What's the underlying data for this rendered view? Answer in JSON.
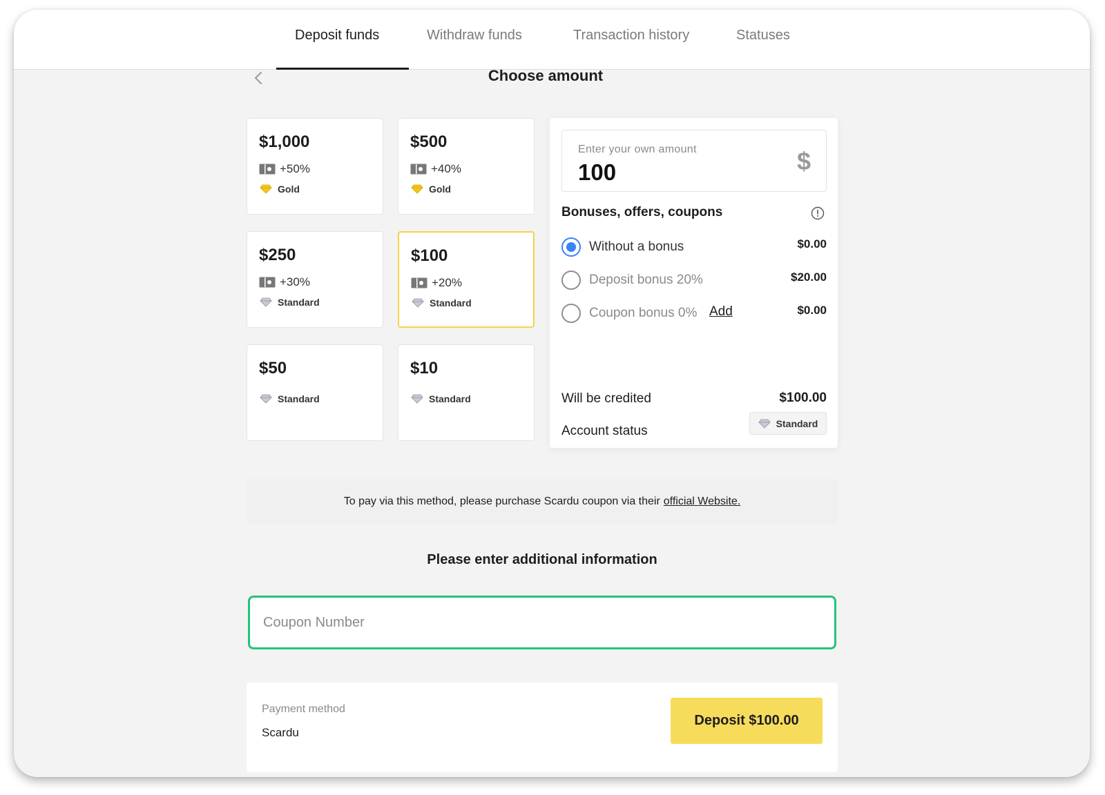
{
  "tabs": [
    {
      "label": "Deposit funds",
      "active": true
    },
    {
      "label": "Withdraw funds",
      "active": false
    },
    {
      "label": "Transaction history",
      "active": false
    },
    {
      "label": "Statuses",
      "active": false
    }
  ],
  "page_title": "Choose amount",
  "cards": [
    {
      "amount": "$1,000",
      "bonus": "+50%",
      "status": "Gold",
      "gem": "gold-gem-icon"
    },
    {
      "amount": "$500",
      "bonus": "+40%",
      "status": "Gold",
      "gem": "gold-gem-icon"
    },
    {
      "amount": "$250",
      "bonus": "+30%",
      "status": "Standard",
      "gem": "standard-gem-icon"
    },
    {
      "amount": "$100",
      "bonus": "+20%",
      "status": "Standard",
      "gem": "standard-gem-icon",
      "selected": true
    },
    {
      "amount": "$50",
      "bonus": "",
      "status": "Standard",
      "gem": "standard-gem-icon"
    },
    {
      "amount": "$10",
      "bonus": "",
      "status": "Standard",
      "gem": "standard-gem-icon"
    }
  ],
  "panel": {
    "amount_label": "Enter your own amount",
    "amount_value": "100",
    "currency_symbol": "$",
    "bonuses_title": "Bonuses, offers, coupons",
    "options": [
      {
        "label": "Without a bonus",
        "value": "$0.00",
        "checked": true
      },
      {
        "label": "Deposit bonus 20%",
        "value": "$20.00",
        "checked": false
      },
      {
        "label": "Coupon bonus 0%",
        "value": "$0.00",
        "checked": false,
        "link": "Add"
      }
    ],
    "credited_label": "Will be credited",
    "credited_value": "$100.00",
    "account_status_label": "Account status",
    "account_status_value": "Standard"
  },
  "notice": {
    "text": "To pay via this method, please purchase Scardu coupon via their",
    "link": "official Website."
  },
  "additional_title": "Please enter additional information",
  "coupon_placeholder": "Coupon Number",
  "payment": {
    "label": "Payment method",
    "value": "Scardu",
    "button": "Deposit $100.00"
  },
  "colors": {
    "accent_yellow": "#f7dc5b",
    "selected_border": "#f3d34a",
    "radio_blue": "#3b82f6",
    "input_green": "#22c37a"
  }
}
